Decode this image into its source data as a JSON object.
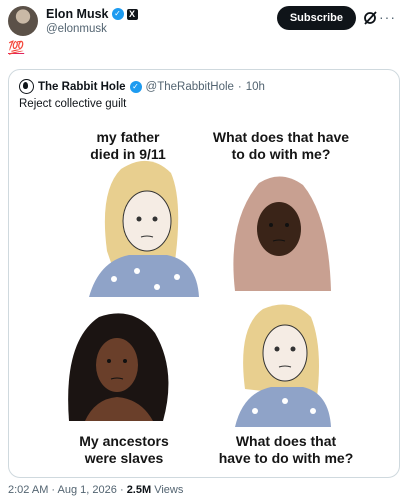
{
  "author": {
    "name": "Elon Musk",
    "handle": "@elonmusk"
  },
  "header": {
    "subscribe_label": "Subscribe",
    "more_label": "···"
  },
  "post": {
    "text": "💯"
  },
  "quoted": {
    "name": "The Rabbit Hole",
    "handle": "@TheRabbitHole",
    "separator": "·",
    "time": "10h",
    "text": "Reject collective guilt",
    "meme": {
      "panel1_line1": "my father",
      "panel1_line2": "died in 9/11",
      "panel2_line1": "What does that have",
      "panel2_line2": "to do with me?",
      "panel3_line1": "My ancestors",
      "panel3_line2": "were slaves",
      "panel4_line1": "What does that",
      "panel4_line2": "have to do with me?"
    }
  },
  "footer": {
    "time": "2:02 AM",
    "sep1": "·",
    "date": "Aug 1, 2026",
    "sep2": "·",
    "views_count": "2.5M",
    "views_label": "Views"
  },
  "colors": {
    "accent": "#1d9bf0",
    "text": "#0f1419",
    "muted": "#536471",
    "border": "#cfd9de"
  },
  "icons": [
    "verified-badge-icon",
    "x-logo-icon",
    "grok-icon",
    "more-icon",
    "hundred-points-emoji"
  ]
}
